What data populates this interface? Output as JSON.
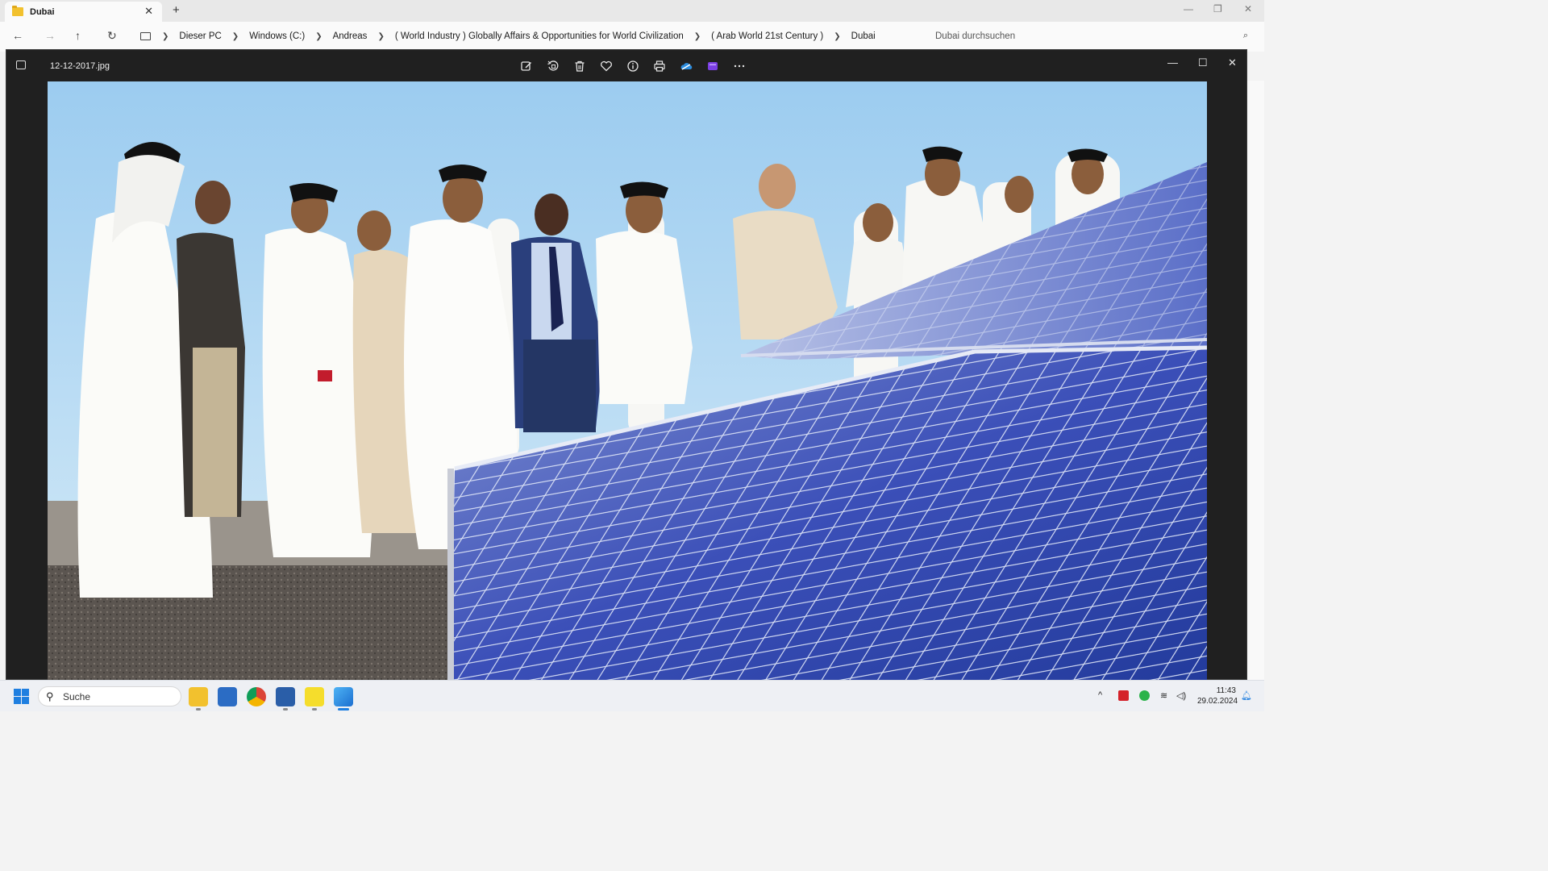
{
  "explorer": {
    "tab_title": "Dubai",
    "new_tab": "+",
    "breadcrumb": [
      "Dieser PC",
      "Windows (C:)",
      "Andreas",
      "( World Industry ) Globally Affairs & Opportunities for World Civilization",
      "( Arab World 21st Century )",
      "Dubai"
    ],
    "search_placeholder": "Dubai durchsuchen"
  },
  "photos": {
    "filename": "12-12-2017.jpg",
    "tools": [
      "edit-icon",
      "rotate-icon",
      "delete-icon",
      "favorite-icon",
      "info-icon",
      "print-icon",
      "onedrive-icon",
      "clipchamp-icon",
      "more-icon"
    ]
  },
  "taskbar": {
    "search_label": "Suche",
    "time": "11:43",
    "date": "29.02.2024"
  }
}
